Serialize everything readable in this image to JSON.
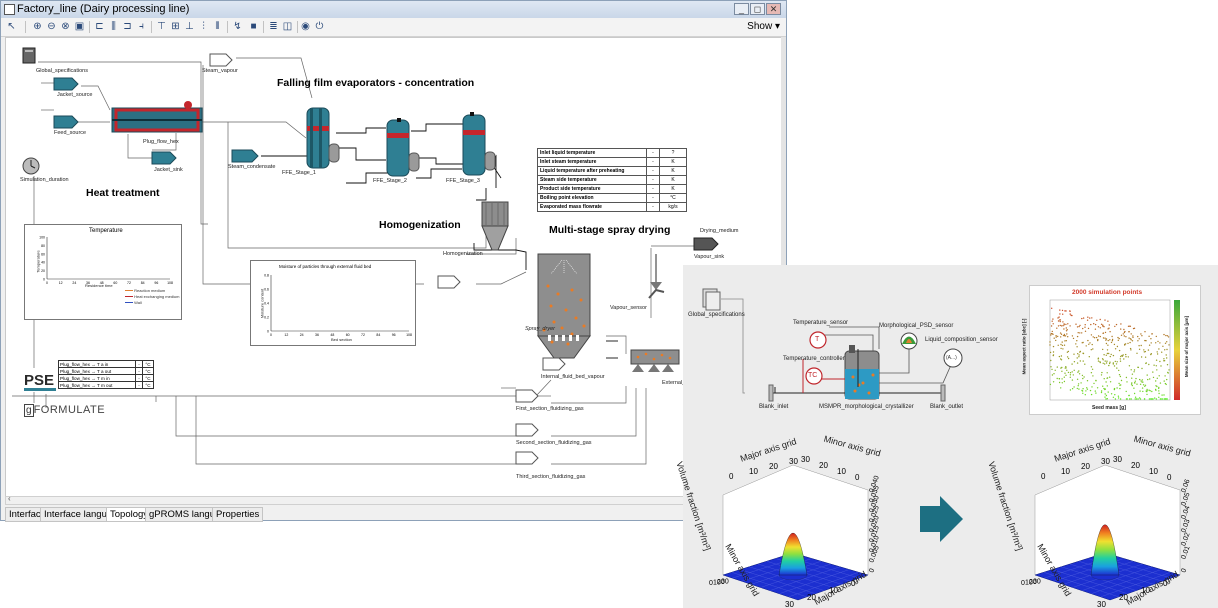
{
  "window": {
    "title": "Factory_line (Dairy processing line)",
    "show_label": "Show",
    "minimize": "_",
    "restore": "◻",
    "close": "✕"
  },
  "toolbar_icons": [
    "pointer-icon",
    "zoom-in-icon",
    "zoom-out-icon",
    "zoom-area-icon",
    "zoom-fit-icon",
    "align-left-icon",
    "align-center-icon",
    "align-right-icon",
    "align-top-icon",
    "align-middle-icon",
    "align-bottom-icon",
    "distribute-icon",
    "connector-icon",
    "stop-icon",
    "list-icon",
    "window-icon",
    "globe-icon",
    "power-icon"
  ],
  "tabs": [
    "Interface",
    "Interface language",
    "Topology",
    "gPROMS language",
    "Properties"
  ],
  "active_tab": "Topology",
  "sections": {
    "ffe": "Falling film evaporators - concentration",
    "heat": "Heat treatment",
    "homog": "Homogenization",
    "spray": "Multi-stage spray drying"
  },
  "units": {
    "global_specs": "Global_specifications",
    "jacket_source": "Jacket_source",
    "feed_source": "Feed_source",
    "plug_flow": "Plug_flow_hex",
    "jacket_sink": "Jacket_sink",
    "sim_duration": "Simulation_duration",
    "steam_vapour": "Steam_vapour",
    "steam_condensate": "Steam_condensate",
    "ffe1": "FFE_Stage_1",
    "ffe2": "FFE_Stage_2",
    "ffe3": "FFE_Stage_3",
    "homogenization": "Homogenization",
    "drying_medium": "Drying_medium",
    "vapour_sink": "Vapour_sink",
    "vapour_sensor": "Vapour_sensor",
    "spray_dryer": "Spray_dryer",
    "internal_bed": "Internal_fluid_bed_vapour",
    "external": "External_f",
    "first_gas": "First_section_fluidizing_gas",
    "second_gas": "Second_section_fluidizing_gas",
    "third_gas": "Third_section_fluidizing_gas"
  },
  "param_table": [
    {
      "label": "Inlet liquid temperature",
      "value": "-",
      "unit": "?"
    },
    {
      "label": "Inlet steam temperature",
      "value": "-",
      "unit": "K"
    },
    {
      "label": "Liquid temperature after preheating",
      "value": "-",
      "unit": "K"
    },
    {
      "label": "Steam side temperature",
      "value": "-",
      "unit": "K"
    },
    {
      "label": "Product side temperature",
      "value": "-",
      "unit": "K"
    },
    {
      "label": "Boiling point elevation",
      "value": "-",
      "unit": "°C"
    },
    {
      "label": "Evaporated mass flowrate",
      "value": "-",
      "unit": "kg/s"
    }
  ],
  "sensor_table": [
    {
      "label": "Plug_flow_hex → T a in",
      "value": "-",
      "unit": "°C"
    },
    {
      "label": "Plug_flow_hex → T a out",
      "value": "-",
      "unit": "°C"
    },
    {
      "label": "Plug_flow_hex → T m in",
      "value": "-",
      "unit": "°C"
    },
    {
      "label": "Plug_flow_hex → T m out",
      "value": "-",
      "unit": "°C"
    }
  ],
  "temp_plot": {
    "title": "Temperature",
    "xlabel": "Residence time",
    "ylabel": "Temperature",
    "yticks": [
      "100",
      "80",
      "60",
      "40",
      "20",
      "0"
    ],
    "xticks": [
      "0",
      "12",
      "24",
      "36",
      "48",
      "60",
      "72",
      "84",
      "96",
      "108"
    ],
    "legend": [
      "Reaction medium",
      "Heat exchanging medium",
      "Wall"
    ]
  },
  "moisture_plot": {
    "title": "Moisture of particles through external fluid bed",
    "xlabel": "Bed section",
    "ylabel": "Moisture content",
    "yticks": [
      "0.8",
      "0.6",
      "0.4",
      "0.2",
      "0"
    ],
    "xticks": [
      "0",
      "12",
      "24",
      "36",
      "48",
      "60",
      "72",
      "84",
      "96",
      "108"
    ]
  },
  "logos": {
    "pse": "PSE",
    "gformulate": "FORMULATE",
    "g": "g"
  },
  "crystallizer": {
    "global_specs": "Global_specifications",
    "temp_sensor": "Temperature_sensor",
    "temp_controller": "Temperature_controller",
    "psd_sensor": "Morphological_PSD_sensor",
    "liq_sensor": "Liquid_composition_sensor",
    "blank_inlet": "Blank_inlet",
    "crystallizer": "MSMPR_morphological_crystallizer",
    "blank_outlet": "Blank_outlet",
    "t_glyph": "T",
    "tc_glyph": "TC",
    "a_glyph": "(A...)"
  },
  "scatter": {
    "title": "2000 simulation points",
    "xlabel": "Seed mass [g]",
    "ylabel_left": "Mean aspect ratio [abc] [-]",
    "ylabel_right": "Mean size of major axis [µm]"
  },
  "surface_left": {
    "zlabel": "Volume fraction [m³/m³]",
    "axis_top_a": "Major axis grid",
    "axis_top_b": "Minor axis grid",
    "axis_bottom_a": "Minor axis grid",
    "axis_bottom_b": "Major axis grid",
    "ticks_top": [
      "0",
      "10",
      "20",
      "30"
    ],
    "ticks_top2": [
      "30",
      "20",
      "10",
      "0"
    ],
    "zticks": [
      "0.040",
      "0.035",
      "0.030",
      "0.025",
      "0.020",
      "0.015",
      "0.010",
      "0.005",
      "0"
    ],
    "ticks_bot_a": [
      "0",
      "10",
      "20",
      "30"
    ],
    "ticks_bot_b": [
      "30",
      "20",
      "10",
      "0"
    ]
  },
  "surface_right": {
    "zlabel": "Volume fraction [m³/m³]",
    "axis_top_a": "Major axis grid",
    "axis_top_b": "Minor axis grid",
    "axis_bottom_a": "Minor axis grid",
    "axis_bottom_b": "Major axis grid",
    "ticks_top": [
      "0",
      "10",
      "20",
      "30"
    ],
    "ticks_top2": [
      "30",
      "20",
      "10",
      "0"
    ],
    "zticks": [
      "0.06",
      "0.05",
      "0.04",
      "0.03",
      "0.02",
      "0.01",
      "0"
    ],
    "ticks_bot_a": [
      "0",
      "10",
      "20",
      "30"
    ],
    "ticks_bot_b": [
      "30",
      "20",
      "10",
      "0"
    ]
  },
  "colors": {
    "accent": "#2f7f93",
    "red": "#c0262c",
    "teal": "#1d6f82"
  }
}
